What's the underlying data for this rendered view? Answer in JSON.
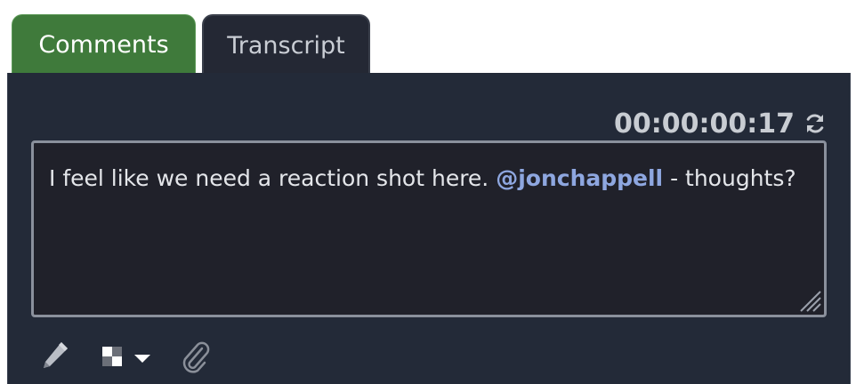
{
  "tabs": [
    {
      "label": "Comments",
      "active": true
    },
    {
      "label": "Transcript",
      "active": false
    }
  ],
  "timecode": "00:00:00:17",
  "comment": {
    "text_before": "I feel like we need a reaction shot here. ",
    "mention": "@jonchappell",
    "text_after": " - thoughts?"
  },
  "toolbar": {
    "icons": [
      "pencil-icon",
      "color-swatch-icon",
      "chevron-down-icon",
      "paperclip-icon"
    ]
  },
  "colors": {
    "active_tab": "#3f7a3b",
    "panel": "#232a38",
    "mention": "#8ea7e0"
  }
}
